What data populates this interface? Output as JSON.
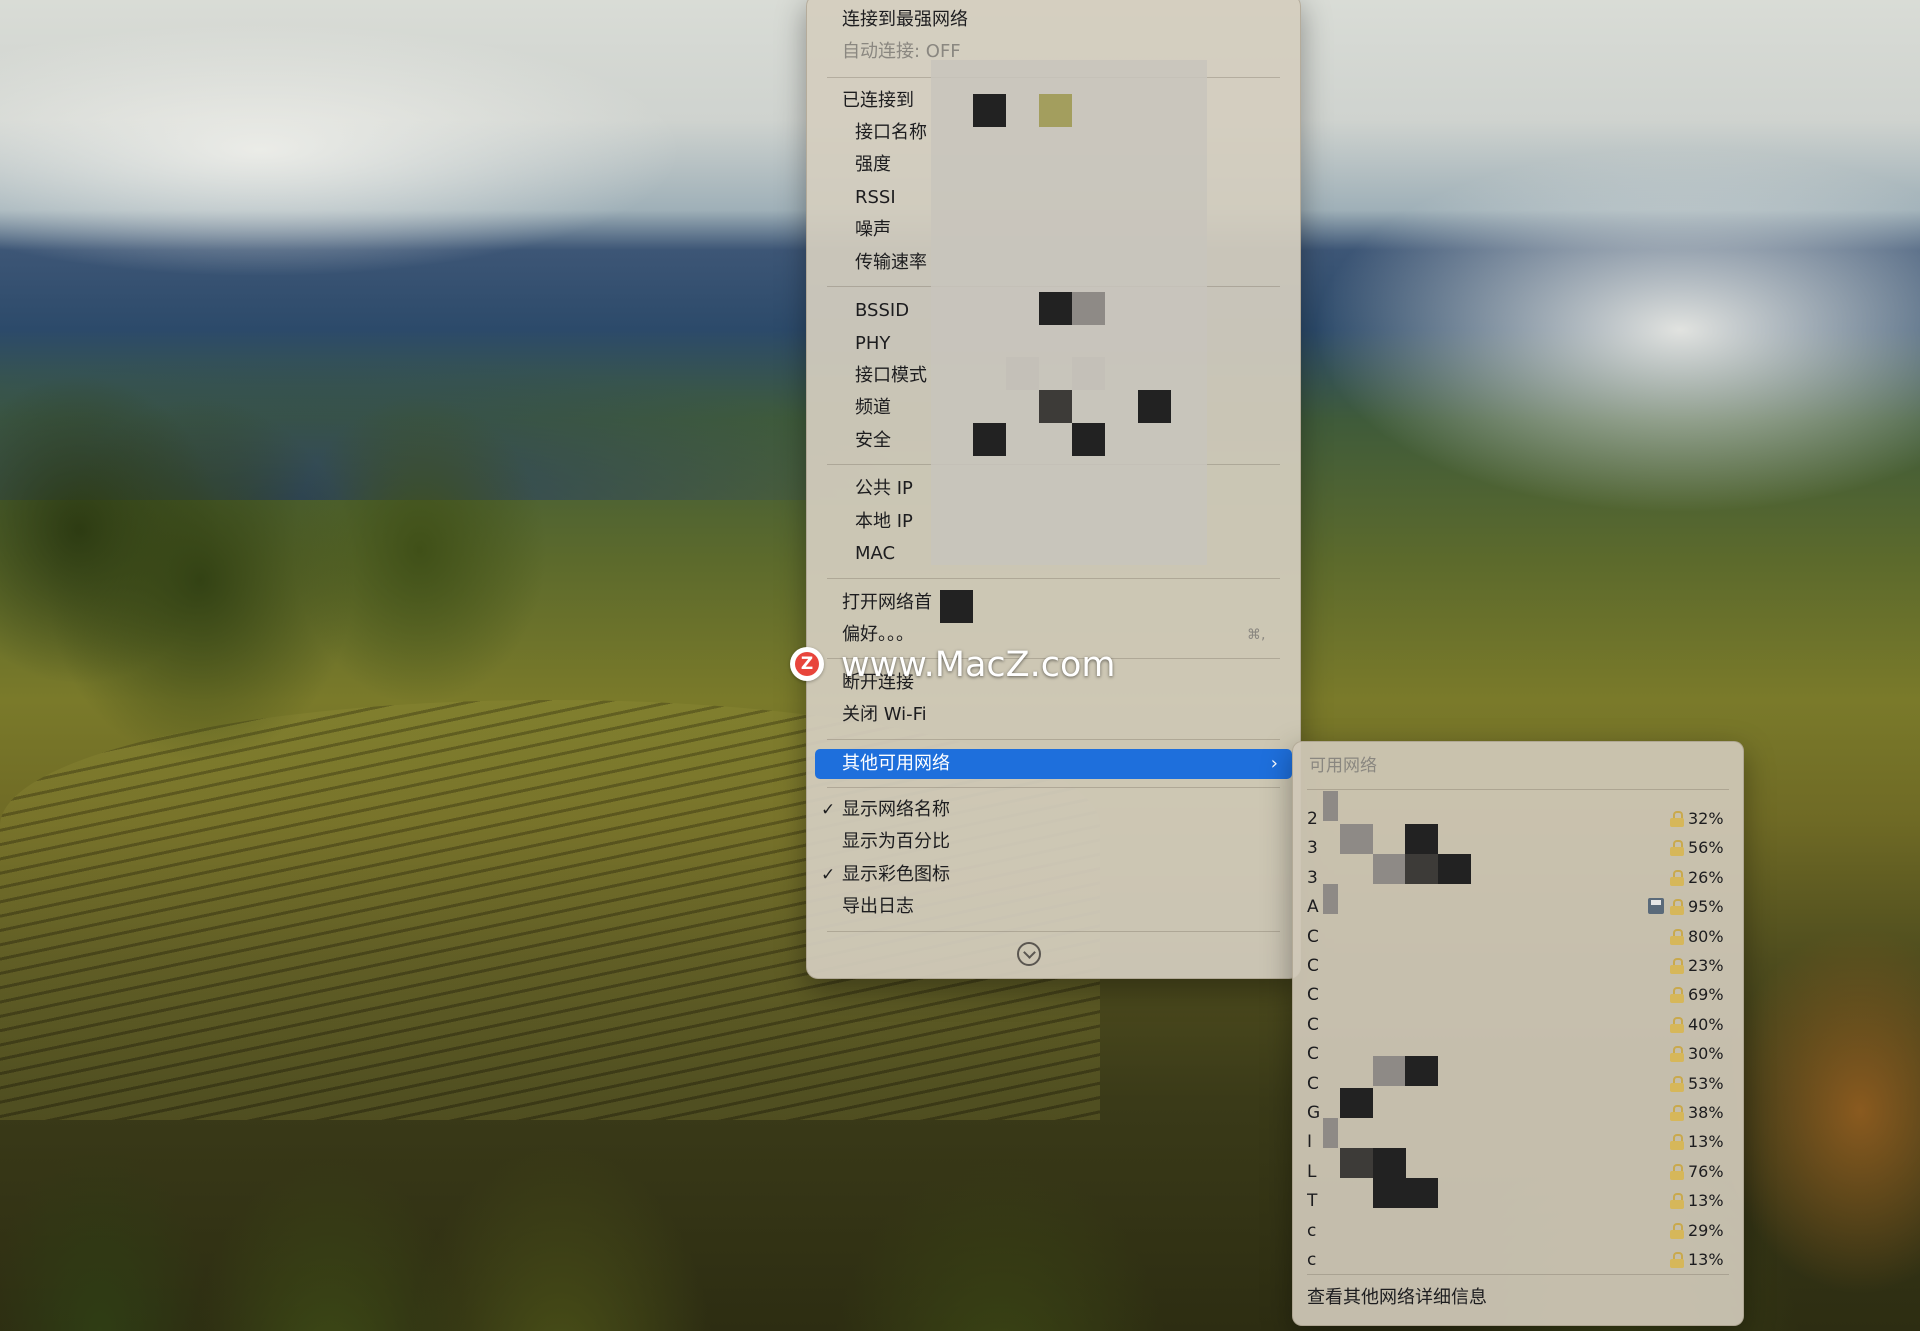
{
  "menu": {
    "connect_strongest": "连接到最强网络",
    "auto_connect": "自动连接: OFF",
    "connected_to": "已连接到",
    "interface_name": "接口名称",
    "strength": "强度",
    "rssi": "RSSI",
    "noise": "噪声",
    "tx_rate": "传输速率",
    "bssid": "BSSID",
    "phy": "PHY",
    "interface_mode": "接口模式",
    "channel": "频道",
    "security": "安全",
    "public_ip": "公共 IP",
    "local_ip": "本地 IP",
    "mac": "MAC",
    "open_network": "打开网络首",
    "preferences": "偏好。。。",
    "preferences_shortcut": "⌘,",
    "disconnect": "断开连接",
    "turn_off_wifi": "关闭 Wi-Fi",
    "other_networks": "其他可用网络",
    "other_networks_chevron": "›",
    "show_network_name": "显示网络名称",
    "show_percentage": "显示为百分比",
    "show_color_icons": "显示彩色图标",
    "export_log": "导出日志",
    "checkmark": "✓"
  },
  "watermark": {
    "logo_letter": "Z",
    "text": "www.MacZ.com"
  },
  "submenu": {
    "header": "可用网络",
    "footer": "查看其他网络详细信息",
    "networks": [
      {
        "name": "2",
        "percent": "32%"
      },
      {
        "name": "3",
        "percent": "56%"
      },
      {
        "name": "3",
        "percent": "26%"
      },
      {
        "name": "A",
        "percent": "95%"
      },
      {
        "name": "C",
        "percent": "80%"
      },
      {
        "name": "C",
        "percent": "23%"
      },
      {
        "name": "C",
        "percent": "69%"
      },
      {
        "name": "C",
        "percent": "40%"
      },
      {
        "name": "C",
        "percent": "30%"
      },
      {
        "name": "C",
        "percent": "53%"
      },
      {
        "name": "G",
        "percent": "38%"
      },
      {
        "name": "I",
        "percent": "13%"
      },
      {
        "name": "L",
        "percent": "76%"
      },
      {
        "name": "T",
        "percent": "13%"
      },
      {
        "name": "c",
        "percent": "29%"
      },
      {
        "name": "c",
        "percent": "13%"
      }
    ]
  }
}
